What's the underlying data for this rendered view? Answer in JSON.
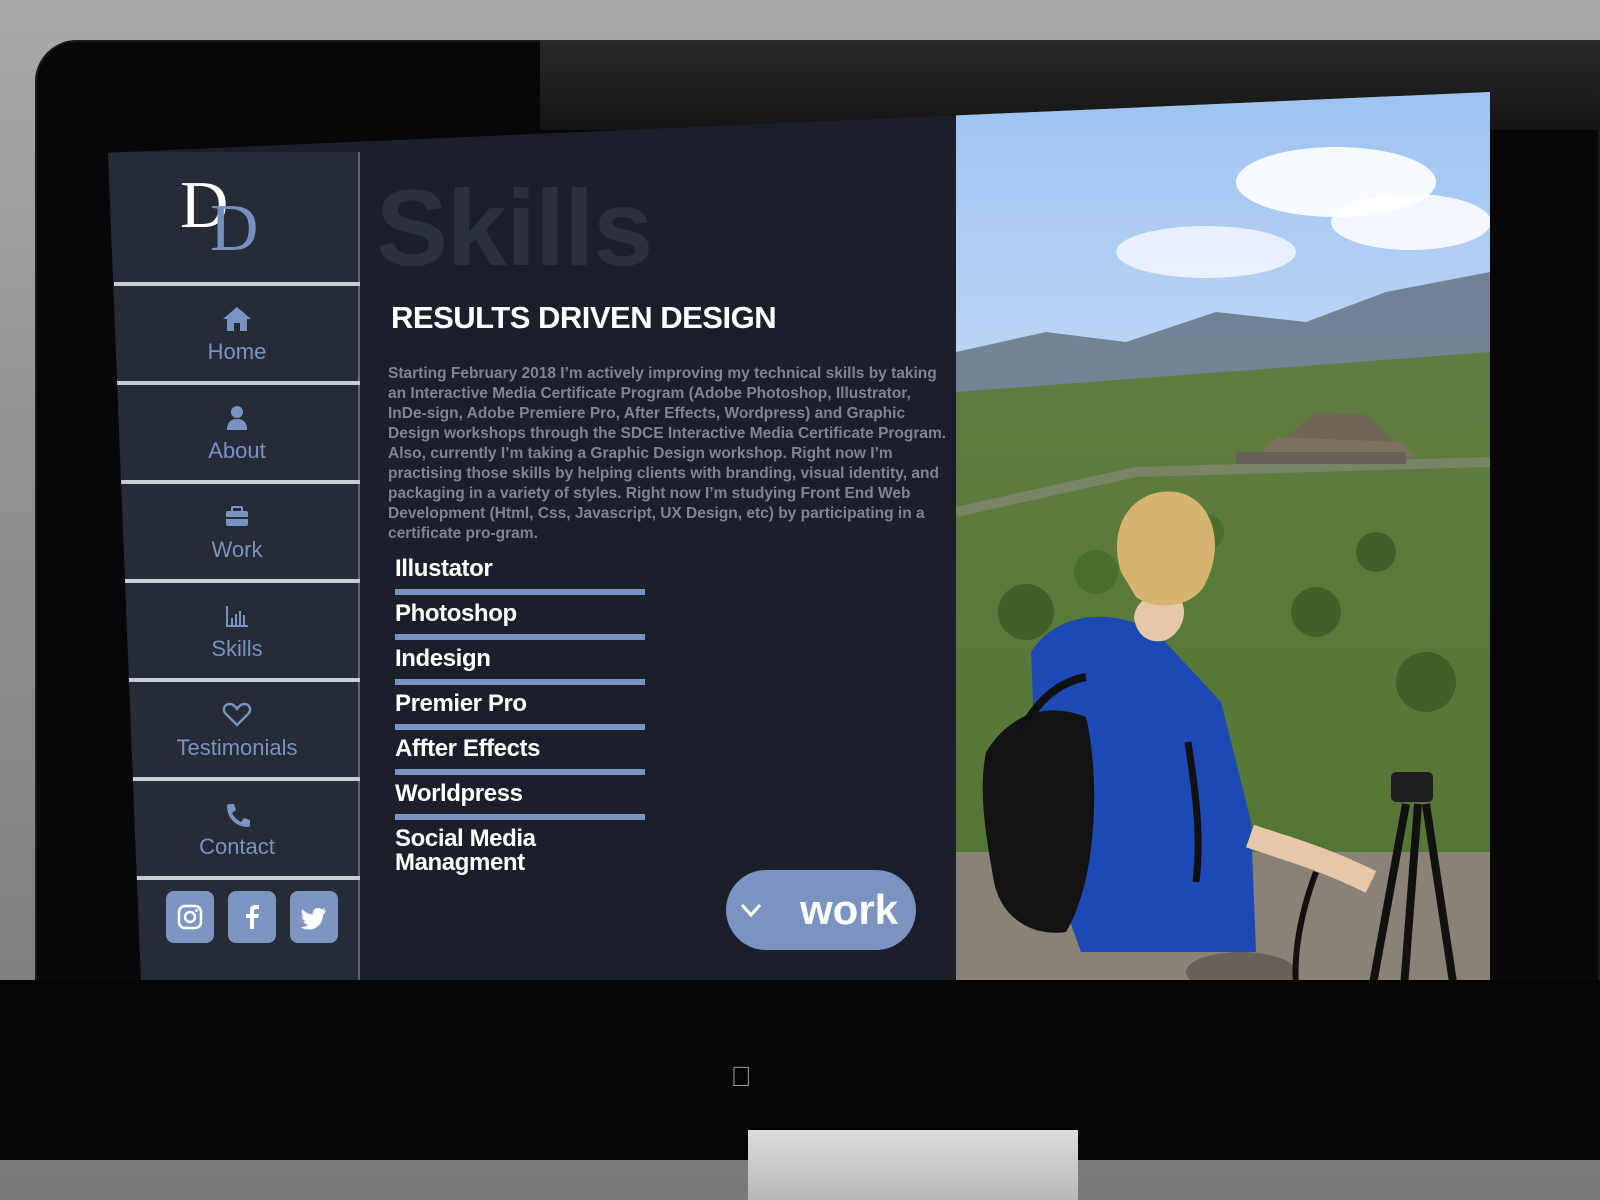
{
  "brand": {
    "logo_letter_1": "D",
    "logo_letter_2": "D"
  },
  "nav": {
    "items": [
      {
        "label": "Home",
        "icon": "home-icon"
      },
      {
        "label": "About",
        "icon": "user-icon"
      },
      {
        "label": "Work",
        "icon": "briefcase-icon"
      },
      {
        "label": "Skills",
        "icon": "chart-icon"
      },
      {
        "label": "Testimonials",
        "icon": "heart-icon"
      },
      {
        "label": "Contact",
        "icon": "phone-icon"
      }
    ]
  },
  "socials": [
    {
      "icon": "instagram-icon"
    },
    {
      "icon": "facebook-icon"
    },
    {
      "icon": "twitter-icon"
    }
  ],
  "content": {
    "section_title": "Skills",
    "headline": "RESULTS DRIVEN DESIGN",
    "body": "Starting February 2018 I’m actively improving my technical skills  by taking an Interactive Media Certificate Program (Adobe Photoshop, Illustrator, InDe-sign, Adobe Premiere Pro, After Effects, Wordpress) and Graphic Design workshops through the SDCE Interactive Media Certificate Program. Also, currently  I’m taking a Graphic Design workshop. Right now I’m practising those skills by helping clients with branding, visual identity, and packaging in a variety of styles. Right now I’m studying Front End Web Development (Html, Css, Javascript, UX Design, etc) by participating in a certificate pro-gram.",
    "skills": [
      "Illustator",
      "Photoshop",
      "Indesign",
      "Premier Pro",
      "Affter Effects",
      "Worldpress",
      "Social Media Managment"
    ],
    "cta": {
      "label": "work",
      "icon": "chevron-down-icon"
    }
  },
  "colors": {
    "accent": "#7b93c0",
    "background": "#1b1f29",
    "sidebar": "#252b37"
  }
}
